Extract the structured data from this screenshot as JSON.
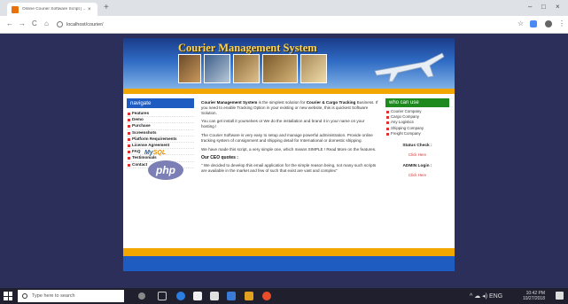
{
  "browser": {
    "tab_title": "Online Courier Software Script | ...",
    "tab_close": "×",
    "new_tab": "+",
    "url": "localhost/courier/",
    "back": "←",
    "forward": "→",
    "reload": "C",
    "home": "⌂",
    "star": "☆",
    "menu": "⋮",
    "minimize": "–",
    "maximize": "□",
    "close": "×"
  },
  "site": {
    "title": "Courier Management System",
    "nav_heading": "navigate",
    "nav_items": [
      "Features",
      "Demo",
      "Purchase",
      "Screenshots",
      "Platform Requirements",
      "License Agreement",
      "FAQ",
      "Testimonials",
      "Contact"
    ],
    "logos": {
      "mysql_a": "My",
      "mysql_b": "SQL",
      "php": "php"
    },
    "paragraphs": {
      "p1_bold": "Courier Management System",
      "p1_mid": " is the simplest solution for ",
      "p1_bold2": "Courier & Cargo Tracking",
      "p1_rest": " Business. If you need to enable Tracking Option in your existing or new website, this is quickest Software Solution.",
      "p2": "You can get install it yourselves or We do the installation and brand it in your name on your hosting !",
      "p3": "The Courier Software is very easy to setup and manage powerful administration. Provide online tracking system of consignment and shipping detail for International or domestic shipping.",
      "p4": "We have made this script, a very simple one, which means SIMPLE ! Read More on the features.",
      "ceo_heading": "Our CEO quotes :",
      "ceo_quote": "\" We decided to develop this email application for the simple reason being, not many such scripts are available in the market and few of such that exist are vast and complex\""
    },
    "who_heading": "who can use",
    "who_items": [
      "Courier Company",
      "Cargo Company",
      "Any Logistics",
      "Shipping Company",
      "Freight Company"
    ],
    "status_title": "Status Check :",
    "status_link": "Click Here",
    "admin_title": "ADMIN Login :",
    "admin_link": "Click Here"
  },
  "taskbar": {
    "search_placeholder": "Type here to search",
    "time": "10:42 PM",
    "date": "10/27/2018",
    "tray_text": "^ ☁ ◂) ENG"
  },
  "colors": {
    "page_bg": "#2b2f5a",
    "nav_blue": "#1f5cc1",
    "accent_yellow": "#f2a600",
    "who_green": "#1e8a1e",
    "link_red": "#dd3333"
  }
}
